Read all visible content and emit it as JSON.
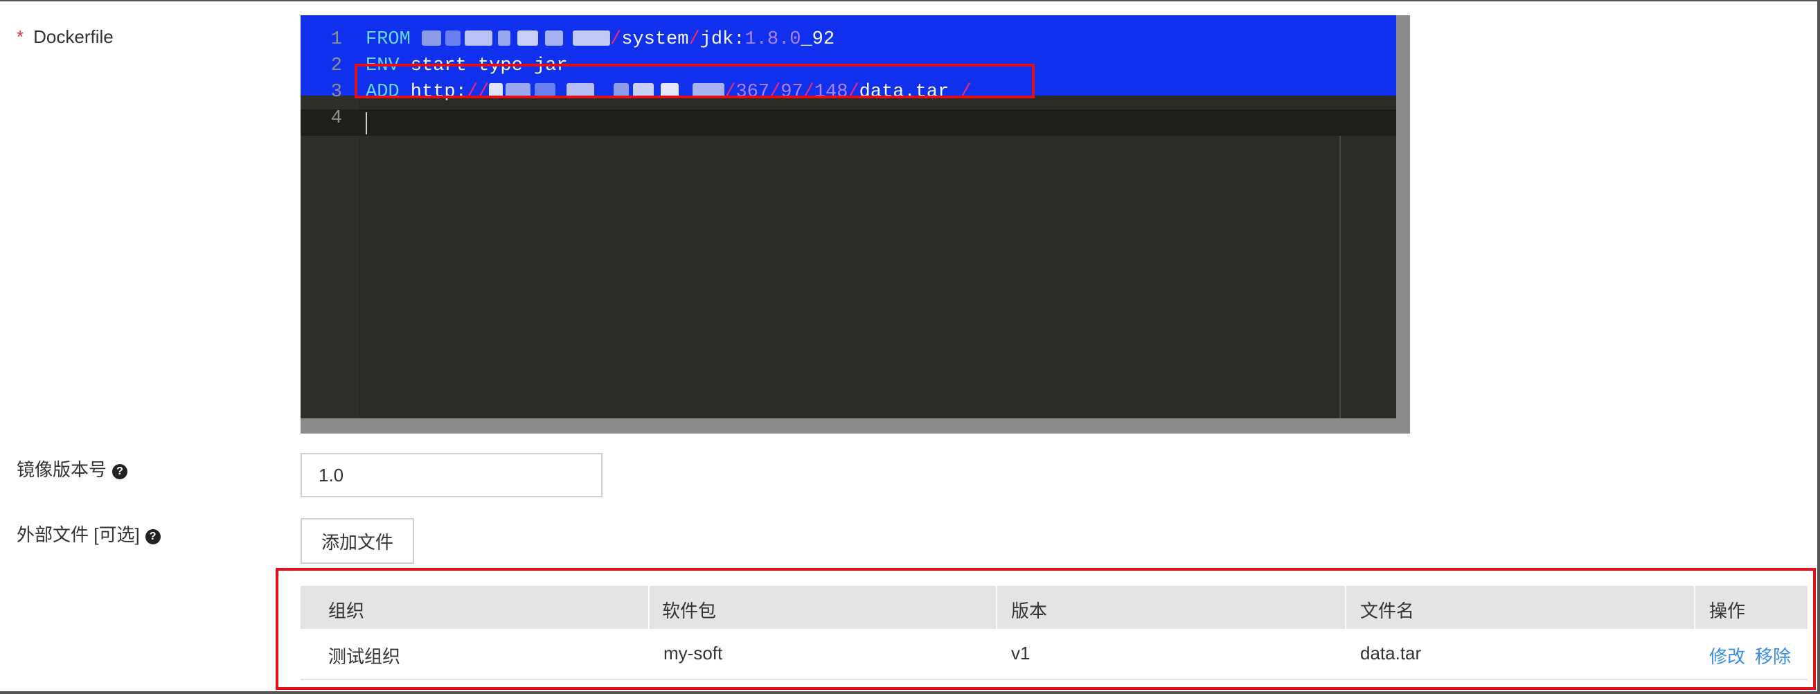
{
  "form": {
    "dockerfile_label": "Dockerfile",
    "required_mark": "*",
    "version_label": "镜像版本号",
    "version_value": "1.0",
    "files_label": "外部文件 [可选]",
    "add_file_button": "添加文件",
    "help_icon_glyph": "?"
  },
  "editor": {
    "line_numbers": [
      "1",
      "2",
      "3",
      "4"
    ],
    "line1": {
      "kw": "FROM",
      "sep1": "/",
      "path1": "system",
      "sep2": "/",
      "image": "jdk",
      "colon": ":",
      "ver_a": "1.8.0",
      "ver_b": "_92"
    },
    "line2": {
      "kw": "ENV",
      "rest": " start type jar"
    },
    "line3": {
      "kw": "ADD",
      "proto": " http:",
      "slashes": "//",
      "sep": "/",
      "p1": "367",
      "s2": "/",
      "p2": "97",
      "s3": "/",
      "p3": "148",
      "s4": "/",
      "file": "data.tar",
      "tail": " /"
    },
    "colors": {
      "keyword": "#66d9ef",
      "slash": "#f92672",
      "number": "#ae81ff",
      "selection": "#1030ee"
    }
  },
  "table": {
    "headers": [
      "组织",
      "软件包",
      "版本",
      "文件名",
      "操作"
    ],
    "rows": [
      {
        "org": "测试组织",
        "package": "my-soft",
        "version": "v1",
        "filename": "data.tar",
        "edit": "修改",
        "remove": "移除"
      }
    ]
  },
  "icons": [
    "question-circle-icon"
  ],
  "accent": {
    "highlight_red": "#e0101a",
    "link_blue": "#3a8ee6"
  }
}
